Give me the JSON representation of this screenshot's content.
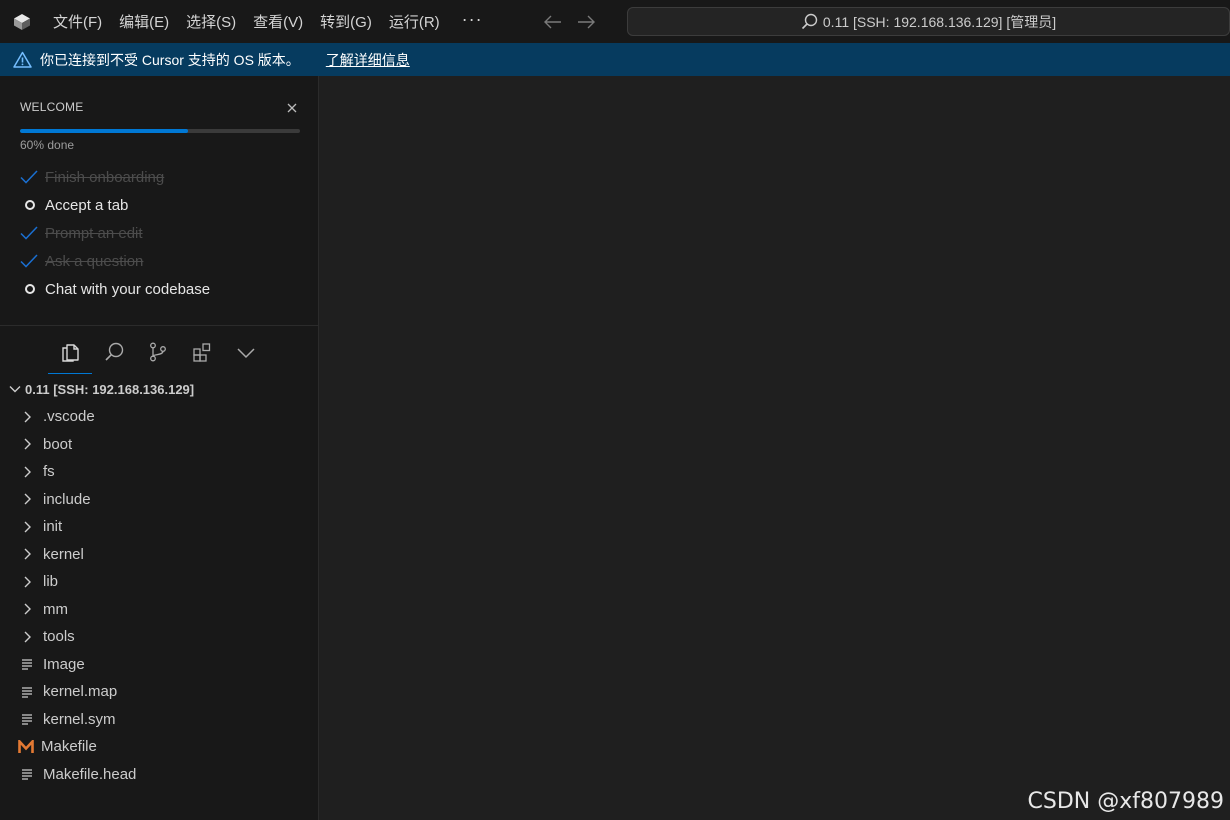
{
  "titlebar": {
    "logo_icon": "cursor-logo-icon",
    "menu": [
      "文件(F)",
      "编辑(E)",
      "选择(S)",
      "查看(V)",
      "转到(G)",
      "运行(R)"
    ],
    "more": "···",
    "search_text": "0.11 [SSH: 192.168.136.129] [管理员]"
  },
  "banner": {
    "message": "你已连接到不受 Cursor 支持的 OS 版本。",
    "link": "了解详细信息",
    "color": "#063b5f"
  },
  "welcome": {
    "title": "WELCOME",
    "progress_percent": 60,
    "progress_text": "60% done",
    "tasks": [
      {
        "label": "Finish onboarding",
        "done": true
      },
      {
        "label": "Accept a tab",
        "done": false
      },
      {
        "label": "Prompt an edit",
        "done": true
      },
      {
        "label": "Ask a question",
        "done": true
      },
      {
        "label": "Chat with your codebase",
        "done": false
      }
    ]
  },
  "explorer": {
    "root_label": "0.11 [SSH: 192.168.136.129]",
    "items": [
      {
        "label": ".vscode",
        "type": "folder"
      },
      {
        "label": "boot",
        "type": "folder"
      },
      {
        "label": "fs",
        "type": "folder"
      },
      {
        "label": "include",
        "type": "folder"
      },
      {
        "label": "init",
        "type": "folder"
      },
      {
        "label": "kernel",
        "type": "folder"
      },
      {
        "label": "lib",
        "type": "folder"
      },
      {
        "label": "mm",
        "type": "folder"
      },
      {
        "label": "tools",
        "type": "folder"
      },
      {
        "label": "Image",
        "type": "file"
      },
      {
        "label": "kernel.map",
        "type": "file"
      },
      {
        "label": "kernel.sym",
        "type": "file"
      },
      {
        "label": "Makefile",
        "type": "makefile"
      },
      {
        "label": "Makefile.head",
        "type": "file"
      }
    ]
  },
  "watermark": "CSDN @xf807989",
  "colors": {
    "accent": "#0078d4",
    "makefile_icon": "#e37933"
  }
}
